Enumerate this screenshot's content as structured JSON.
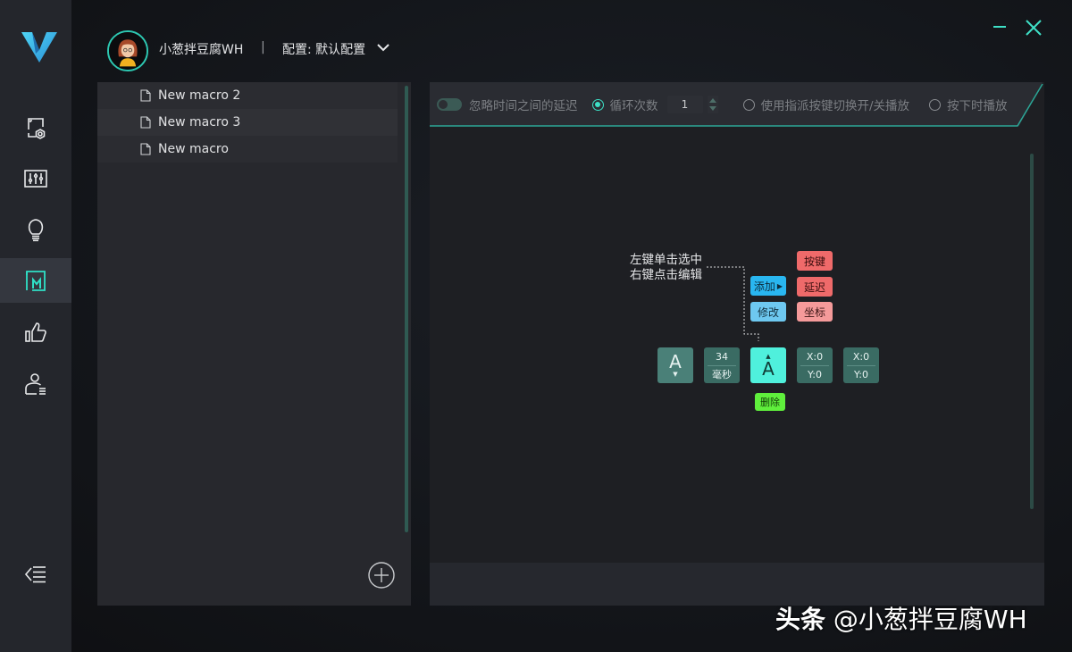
{
  "sidebar": {
    "items": [
      {
        "id": "device-settings",
        "icon": "device-settings-icon",
        "active": false
      },
      {
        "id": "equalizer",
        "icon": "equalizer-icon",
        "active": false
      },
      {
        "id": "lighting",
        "icon": "lightbulb-icon",
        "active": false
      },
      {
        "id": "macro",
        "icon": "macro-icon",
        "active": true
      },
      {
        "id": "recommend",
        "icon": "thumbs-up-icon",
        "active": false
      },
      {
        "id": "account",
        "icon": "user-list-icon",
        "active": false
      }
    ],
    "collapse_icon": "collapse-menu-icon"
  },
  "header": {
    "username": "小葱拌豆腐WH",
    "separator": "|",
    "config_label": "配置: 默认配置"
  },
  "macro_list": {
    "items": [
      {
        "label": "New macro 2"
      },
      {
        "label": "New macro 3"
      },
      {
        "label": "New macro"
      }
    ]
  },
  "toolbar": {
    "ignore_delay_label": "忽略时间之间的延迟",
    "ignore_delay_on": false,
    "loop_label": "循环次数",
    "loop_value": "1",
    "assign_toggle_label": "使用指派按键切换开/关播放",
    "hold_play_label": "按下时播放",
    "selected_mode": "loop"
  },
  "editor": {
    "hint_line1": "左键单击选中",
    "hint_line2": "右键点击编辑",
    "add_label": "添加",
    "modify_label": "修改",
    "key_label": "按键",
    "delay_label": "延迟",
    "coord_label": "坐标",
    "delete_label": "删除",
    "tiles": [
      {
        "type": "key-down",
        "text": "A"
      },
      {
        "type": "delay",
        "value": "34",
        "unit": "毫秒"
      },
      {
        "type": "key-up",
        "text": "A",
        "selected": true
      },
      {
        "type": "coord",
        "x": "X:0",
        "y": "Y:0"
      },
      {
        "type": "coord",
        "x": "X:0",
        "y": "Y:0"
      }
    ]
  },
  "colors": {
    "accent": "#2dc7b1",
    "add_blue": "#29b6f0",
    "modify_blue": "#6ec8f0",
    "key_red": "#ef6a6a",
    "coord_pink": "#f59a9a",
    "delete_green": "#5fef3c",
    "tile_teal": "#3f7b72",
    "tile_selected": "#4ff0dc"
  },
  "watermark": {
    "brand": "头条",
    "handle": "@小葱拌豆腐WH"
  }
}
